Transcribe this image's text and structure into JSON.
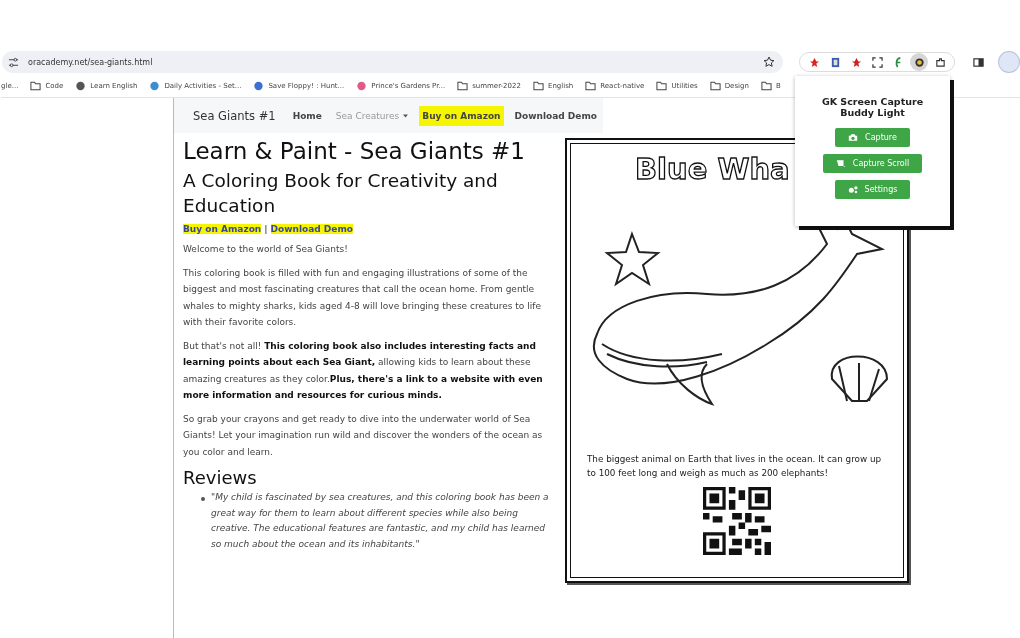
{
  "browser": {
    "url": "oracademy.net/sea-giants.html",
    "extensions": [
      {
        "selected": false
      },
      {
        "selected": false
      },
      {
        "selected": false
      },
      {
        "selected": false
      },
      {
        "selected": false
      },
      {
        "selected": true
      },
      {
        "selected": false
      }
    ],
    "bookmarks": [
      {
        "kind": "site",
        "label": "gle..."
      },
      {
        "kind": "folder",
        "label": "Code"
      },
      {
        "kind": "site",
        "label": "Learn English"
      },
      {
        "kind": "site",
        "label": "Daily Activities - Set..."
      },
      {
        "kind": "site",
        "label": "Save Floppy! : Hunt..."
      },
      {
        "kind": "site",
        "label": "Prince's Gardens Pr..."
      },
      {
        "kind": "folder",
        "label": "summer-2022"
      },
      {
        "kind": "folder",
        "label": "English"
      },
      {
        "kind": "folder",
        "label": "React-native"
      },
      {
        "kind": "folder",
        "label": "Utilities"
      },
      {
        "kind": "folder",
        "label": "Design"
      },
      {
        "kind": "folder",
        "label": "B"
      }
    ]
  },
  "navbar": {
    "brand": "Sea Giants #1",
    "items": [
      {
        "kind": "link",
        "label": "Home",
        "highlighted": false
      },
      {
        "kind": "dropdown",
        "label": "Sea Creatures",
        "highlighted": false
      },
      {
        "kind": "link",
        "label": "Buy on Amazon",
        "highlighted": true
      },
      {
        "kind": "link",
        "label": "Download Demo",
        "highlighted": false
      }
    ]
  },
  "article": {
    "title": "Learn & Paint - Sea Giants #1",
    "subtitle": "A Coloring Book for Creativity and Education",
    "links": [
      {
        "label": "Buy on Amazon"
      },
      {
        "label": "Download Demo"
      }
    ],
    "link_separator": "|",
    "paragraphs": [
      "Welcome to the world of Sea Giants!",
      "This coloring book is filled with fun and engaging illustrations of some of the biggest and most fascinating creatures that call the ocean home. From gentle whales to mighty sharks, kids aged 4-8 will love bringing these creatures to life with their favorite colors.",
      "But that's not all! **This coloring book also includes interesting facts and learning points about each Sea Giant,** allowing kids to learn about these amazing creatures as they color.**Plus, there's a link to a website with even more information and resources for curious minds.**",
      "So grab your crayons and get ready to dive into the underwater world of Sea Giants! Let your imagination run wild and discover the wonders of the ocean as you color and learn."
    ],
    "reviews_heading": "Reviews",
    "reviews": [
      "\"My child is fascinated by sea creatures, and this coloring book has been a great way for them to learn about different species while also being creative. The educational features are fantastic, and my child has learned so much about the ocean and its inhabitants.\""
    ]
  },
  "coloring_page": {
    "title": "Blue Wha",
    "caption": "The biggest animal on Earth that lives in the ocean. It can grow up to 100 feet long and weigh as much as 200 elephants!"
  },
  "popup": {
    "title": "GK Screen Capture Buddy Light",
    "buttons": [
      {
        "kind": "capture",
        "label": "Capture"
      },
      {
        "kind": "scroll",
        "label": "Capture Scroll"
      },
      {
        "kind": "settings",
        "label": "Settings"
      }
    ]
  }
}
